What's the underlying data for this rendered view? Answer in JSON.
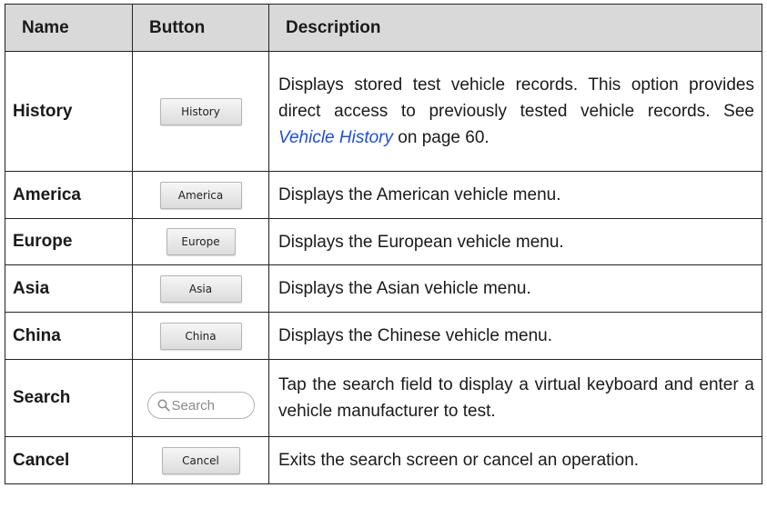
{
  "headers": {
    "name": "Name",
    "button": "Button",
    "description": "Description"
  },
  "rows": [
    {
      "name": "History",
      "button": "History",
      "desc_before": "Displays stored test vehicle records. This option provides direct access to previously tested vehicle records. See ",
      "desc_link": "Vehicle History",
      "desc_after": " on page 60."
    },
    {
      "name": "America",
      "button": "America",
      "desc": "Displays the American vehicle menu."
    },
    {
      "name": "Europe",
      "button": "Europe",
      "desc": "Displays the European vehicle menu."
    },
    {
      "name": "Asia",
      "button": "Asia",
      "desc": "Displays the Asian vehicle menu."
    },
    {
      "name": "China",
      "button": "China",
      "desc": "Displays the Chinese vehicle menu."
    },
    {
      "name": "Search",
      "search_placeholder": "Search",
      "search_icon": "magnifier-icon",
      "desc": "Tap the search field to display a virtual keyboard and enter a vehicle manufacturer to test."
    },
    {
      "name": "Cancel",
      "button": "Cancel",
      "desc": "Exits the search screen or cancel an operation."
    }
  ],
  "colors": {
    "header_bg": "#d9d9d9",
    "border": "#222222",
    "link": "#1f4fd8"
  }
}
